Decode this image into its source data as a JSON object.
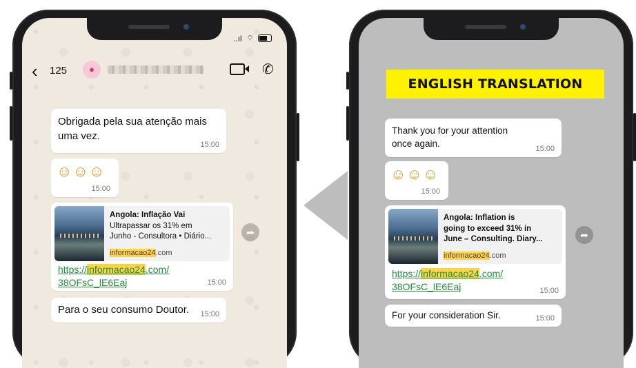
{
  "colors": {
    "banner": "#fff200",
    "highlight": "#ffd24a",
    "link": "#1f8f3a",
    "chat_bg_left": "#efe9df",
    "chat_bg_right": "#bdbdbd"
  },
  "left": {
    "status": {
      "signal": "..ıl",
      "wifi": "wifi-icon",
      "battery": "battery-icon"
    },
    "header": {
      "back_icon": "chevron-left-icon",
      "back_glyph": "‹",
      "back_count": "125",
      "avatar_glyph": "●",
      "video_icon": "video-camera-icon",
      "call_icon": "phone-icon",
      "call_glyph": "✆"
    },
    "messages": {
      "m1": {
        "line1": "Obrigada pela sua atenção mais",
        "line2": "uma vez.",
        "time": "15:00"
      },
      "m2": {
        "emojis": "☺☺☺",
        "time": "15:00"
      },
      "m3": {
        "title1": "Angola: Inflação Vai",
        "title2": "Ultrapassar os 31% em",
        "title3": "Junho - Consultora • Diário...",
        "domain_hl": "informacao24",
        "domain_rest": ".com",
        "url_pre": "https://",
        "url_hl": "informacao24",
        "url_post": ".com/",
        "url_line2": "38OFsC_lE6Eaj",
        "time": "15:00"
      },
      "m4": {
        "text": "Para o seu consumo Doutor.",
        "time": "15:00"
      }
    },
    "share_glyph": "➦"
  },
  "right": {
    "banner": "ENGLISH TRANSLATION",
    "messages": {
      "m1": {
        "line1": "Thank you for your attention",
        "line2": "once again.",
        "time": "15:00"
      },
      "m2": {
        "emojis": "☺☺☺",
        "time": "15:00"
      },
      "m3": {
        "title1": "Angola: Inflation is",
        "title2": "going to exceed 31% in",
        "title3": "June – Consulting. Diary...",
        "domain_hl": "informacao24",
        "domain_rest": ".com",
        "url_pre": "https://",
        "url_hl": "informacao24",
        "url_post": ".com/",
        "url_line2": "38OFsC_lE6Eaj",
        "time": "15:00"
      },
      "m4": {
        "text": "For your consideration Sir.",
        "time": "15:00"
      }
    },
    "share_glyph": "➦"
  }
}
